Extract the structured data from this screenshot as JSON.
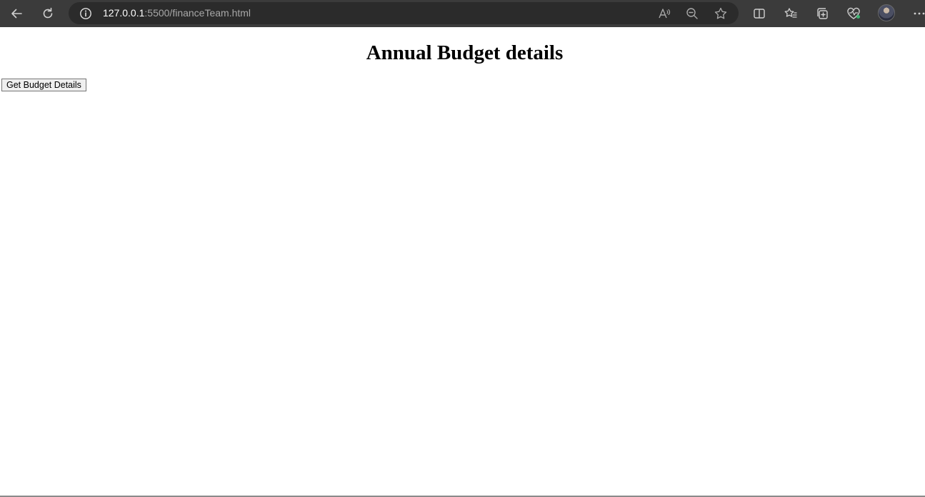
{
  "browser": {
    "address": {
      "host": "127.0.0.1",
      "path": ":5500/financeTeam.html"
    },
    "icons": {
      "back": "back-arrow-icon",
      "refresh": "refresh-icon",
      "info": "info-icon",
      "read_aloud": "read-aloud-icon",
      "zoom": "zoom-out-icon",
      "favorite": "star-icon",
      "split": "split-screen-icon",
      "favorites": "favorites-list-icon",
      "collections": "collections-icon",
      "health": "browser-essentials-icon",
      "profile": "profile-avatar",
      "more": "more-menu-icon"
    },
    "colors": {
      "toolbar": "#3b3b3b",
      "address_bg": "#2b2b2b",
      "icon": "#d0d0d0",
      "health_badge": "#3cb371"
    }
  },
  "page": {
    "title": "Annual Budget details",
    "button_label": "Get Budget Details"
  }
}
